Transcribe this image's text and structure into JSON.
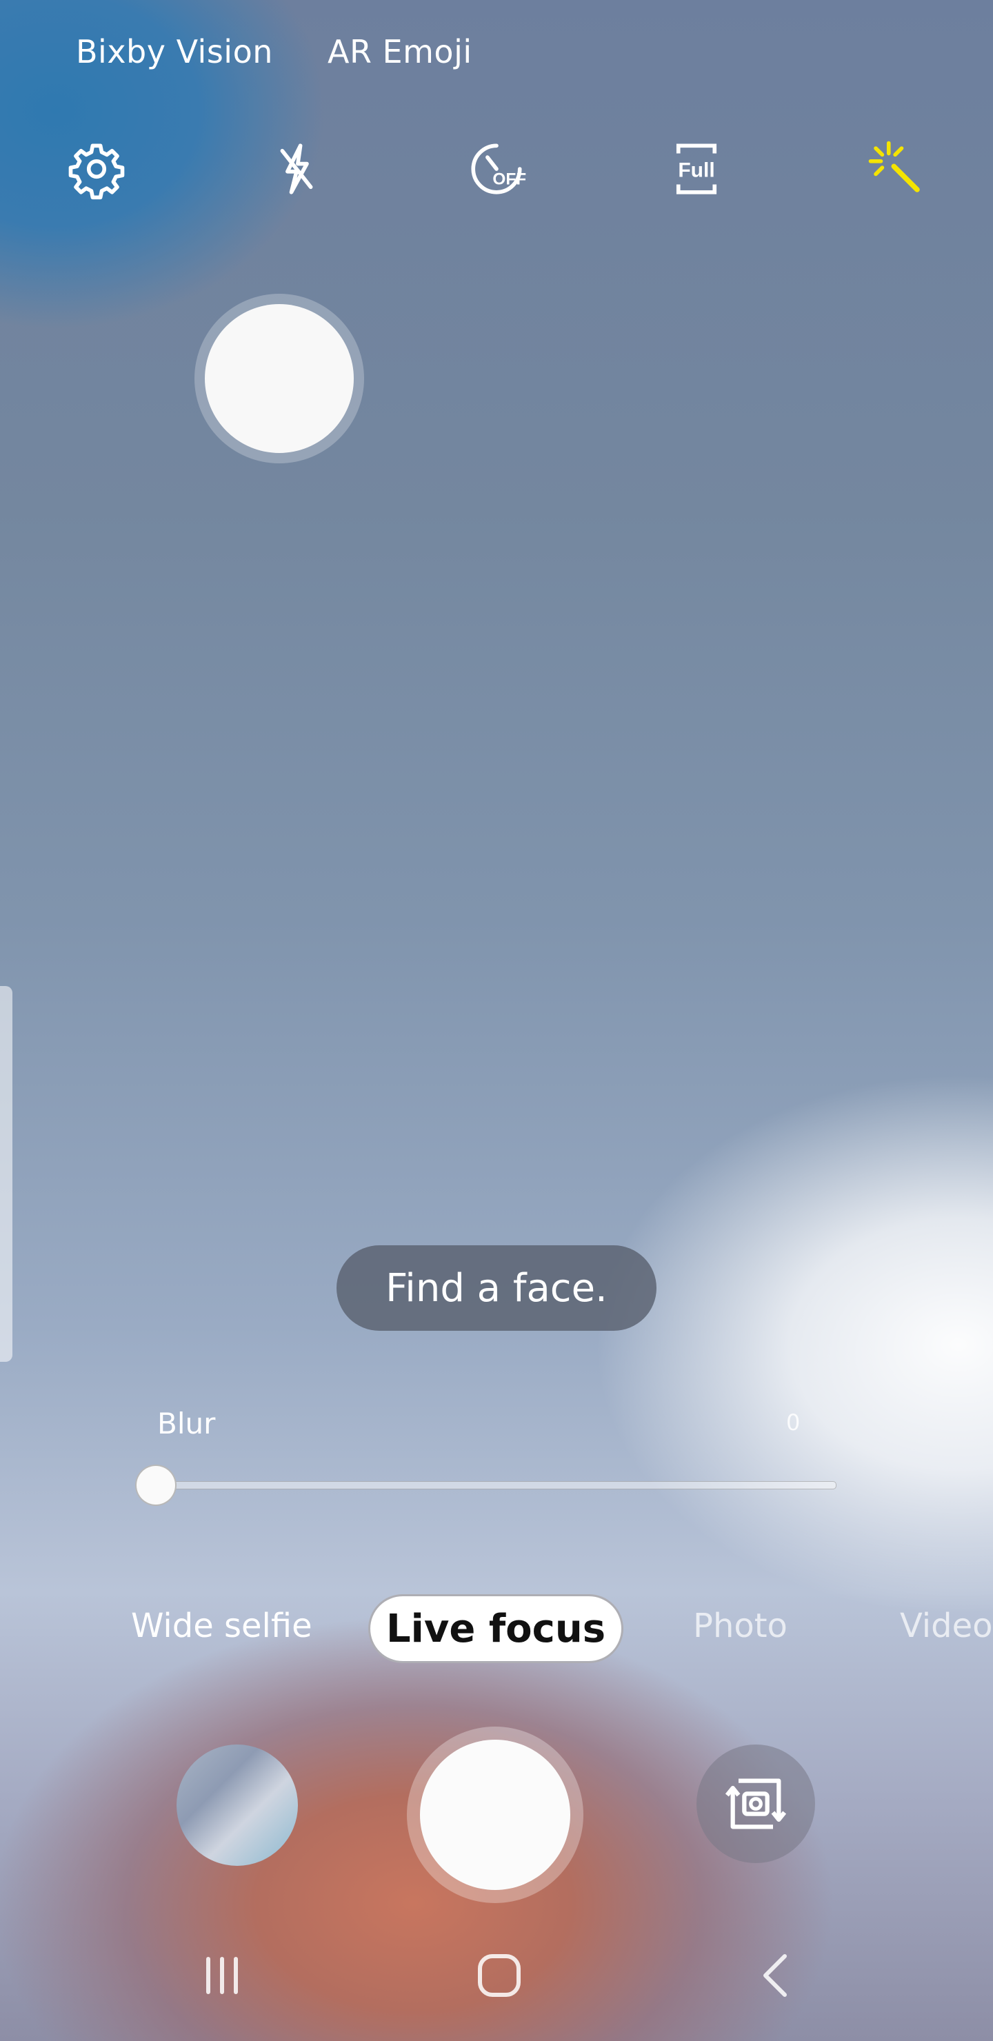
{
  "top_links": {
    "bixby_vision": "Bixby Vision",
    "ar_emoji": "AR Emoji"
  },
  "toolbar": {
    "settings_icon": "gear-icon",
    "flash_icon": "flash-off-icon",
    "timer_icon": "timer-off-icon",
    "timer_label": "OFF",
    "ratio_label": "Full",
    "effects_icon": "magic-wand-icon",
    "effects_color": "#f5e400"
  },
  "toast": {
    "message": "Find a face."
  },
  "blur": {
    "label": "Blur",
    "value": "0",
    "level": 0
  },
  "modes": {
    "wide_selfie": "Wide selfie",
    "live_focus": "Live focus",
    "photo": "Photo",
    "video": "Video",
    "selected": "Live focus"
  },
  "bottom": {
    "gallery_icon": "gallery-thumbnail",
    "switch_icon": "switch-camera-icon"
  },
  "nav": {
    "recent_icon": "recent-apps-icon",
    "home_icon": "home-icon",
    "back_icon": "back-icon"
  }
}
